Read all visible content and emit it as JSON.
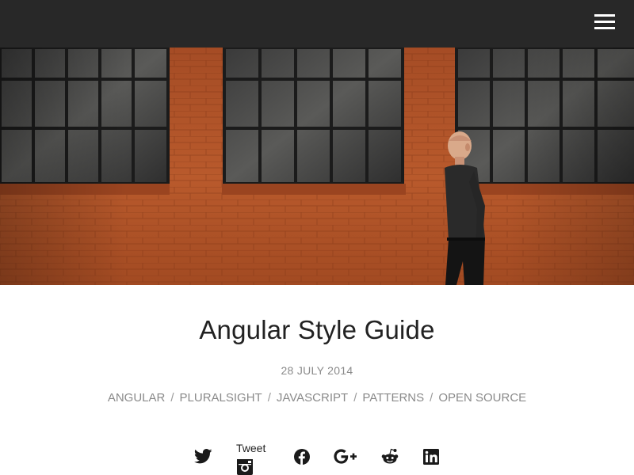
{
  "header": {
    "menu_icon": "hamburger-menu-icon",
    "background": "#282828"
  },
  "hero": {
    "description_icon": "hero-photo",
    "brick_color": "#b0552a"
  },
  "post": {
    "title": "Angular Style Guide",
    "date": "28 JULY 2014",
    "tags": [
      "ANGULAR",
      "PLURALSIGHT",
      "JAVASCRIPT",
      "PATTERNS",
      "OPEN SOURCE"
    ],
    "tag_separator": "/"
  },
  "share": {
    "tweet_label": "Tweet",
    "icons": [
      "twitter-icon",
      "instagram-icon",
      "facebook-icon",
      "google-plus-icon",
      "reddit-icon",
      "linkedin-icon"
    ]
  }
}
